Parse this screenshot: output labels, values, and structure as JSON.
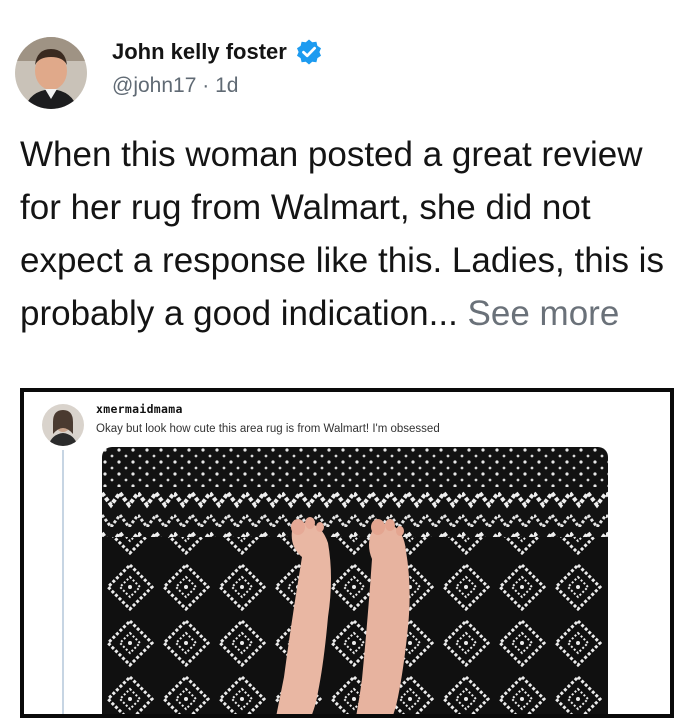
{
  "author": {
    "name": "John kelly foster",
    "handle": "@john17",
    "separator": " · ",
    "time": "1d",
    "verified_icon": "verified-badge-icon",
    "colors": {
      "verified": "#1d9bf0"
    }
  },
  "post": {
    "text": "When this woman posted a great review for her rug from Walmart, she did not expect a response like this. Ladies, this is probably a good indication...",
    "see_more_label": "See more"
  },
  "embedded_post": {
    "handle": "xmermaidmama",
    "text": "Okay but look how cute this area rug is from Walmart! I'm obsessed"
  }
}
